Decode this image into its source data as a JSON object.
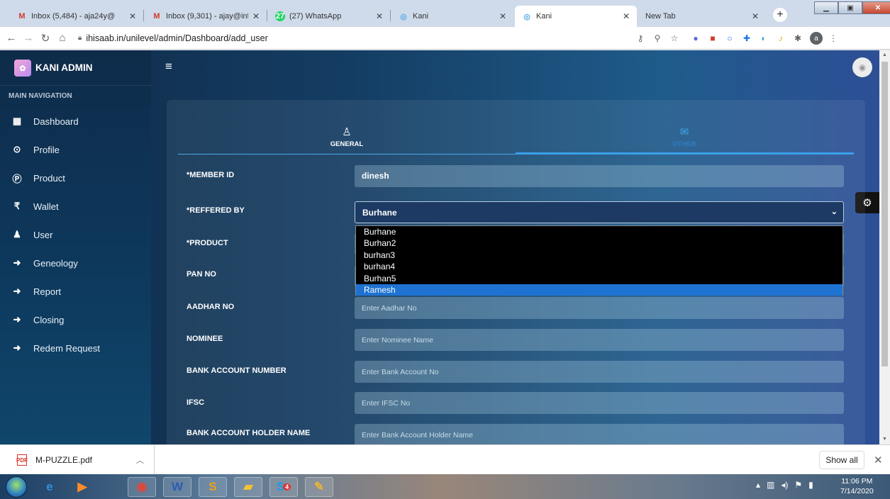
{
  "browser": {
    "tabs": [
      {
        "icon": "gmail-icon",
        "label": "Inbox (5,484) - aja24y@",
        "active": false
      },
      {
        "icon": "gmail-icon",
        "label": "Inbox (9,301) - ajay@inf",
        "active": false
      },
      {
        "icon": "whatsapp-icon",
        "badge": "27",
        "label": "(27) WhatsApp",
        "active": false
      },
      {
        "icon": "kani-icon",
        "label": "Kani",
        "active": false
      },
      {
        "icon": "kani-icon",
        "label": "Kani",
        "active": true
      },
      {
        "icon": "",
        "label": "New Tab",
        "active": false
      }
    ],
    "url": "ihisaab.in/unilevel/admin/Dashboard/add_user",
    "profile_letter": "a"
  },
  "app": {
    "brand": "KANI ADMIN",
    "nav_heading": "MAIN NAVIGATION",
    "nav_items": [
      {
        "icon": "dashboard-icon",
        "label": "Dashboard"
      },
      {
        "icon": "profile-icon",
        "label": "Profile"
      },
      {
        "icon": "product-icon",
        "label": "Product"
      },
      {
        "icon": "rupee-icon",
        "label": "Wallet"
      },
      {
        "icon": "user-icon",
        "label": "User"
      },
      {
        "icon": "arrow-right-icon",
        "label": "Geneology"
      },
      {
        "icon": "arrow-right-icon",
        "label": "Report"
      },
      {
        "icon": "arrow-right-icon",
        "label": "Closing"
      },
      {
        "icon": "arrow-right-icon",
        "label": "Redem Request"
      }
    ],
    "form_tabs": [
      {
        "icon": "user-outline-icon",
        "label": "GENERAL",
        "active": true
      },
      {
        "icon": "envelope-open-icon",
        "label": "OTHER",
        "active": false
      }
    ],
    "fields": {
      "member_id": {
        "label": "*MEMBER ID",
        "value": "dinesh"
      },
      "reffered_by": {
        "label": "*REFFERED BY",
        "value": "Burhane"
      },
      "product": {
        "label": "*PRODUCT"
      },
      "pan_no": {
        "label": "PAN NO"
      },
      "aadhar_no": {
        "label": "AADHAR NO",
        "placeholder": "Enter Aadhar No"
      },
      "nominee": {
        "label": "NOMINEE",
        "placeholder": "Enter Nominee Name"
      },
      "bank_account_number": {
        "label": "BANK ACCOUNT NUMBER",
        "placeholder": "Enter Bank Account No"
      },
      "ifsc": {
        "label": "IFSC",
        "placeholder": "Enter IFSC No"
      },
      "bank_account_holder_name": {
        "label": "BANK ACCOUNT HOLDER NAME",
        "placeholder": "Enter Bank Account Holder Name"
      }
    },
    "reffered_by_options": [
      "Burhane",
      "Burhan2",
      "burhan3",
      "burhan4",
      "Burhan5",
      "Ramesh"
    ],
    "highlighted_option": "Ramesh"
  },
  "downloads": {
    "file": "M-PUZZLE.pdf",
    "show_all": "Show all"
  },
  "taskbar": {
    "time": "11:06 PM",
    "date": "7/14/2020",
    "s4_badge": "4"
  },
  "colors": {
    "accent": "#3aa0ea",
    "dropdown_highlight": "#1e73d2",
    "sidebar": "#0e2b4a"
  }
}
